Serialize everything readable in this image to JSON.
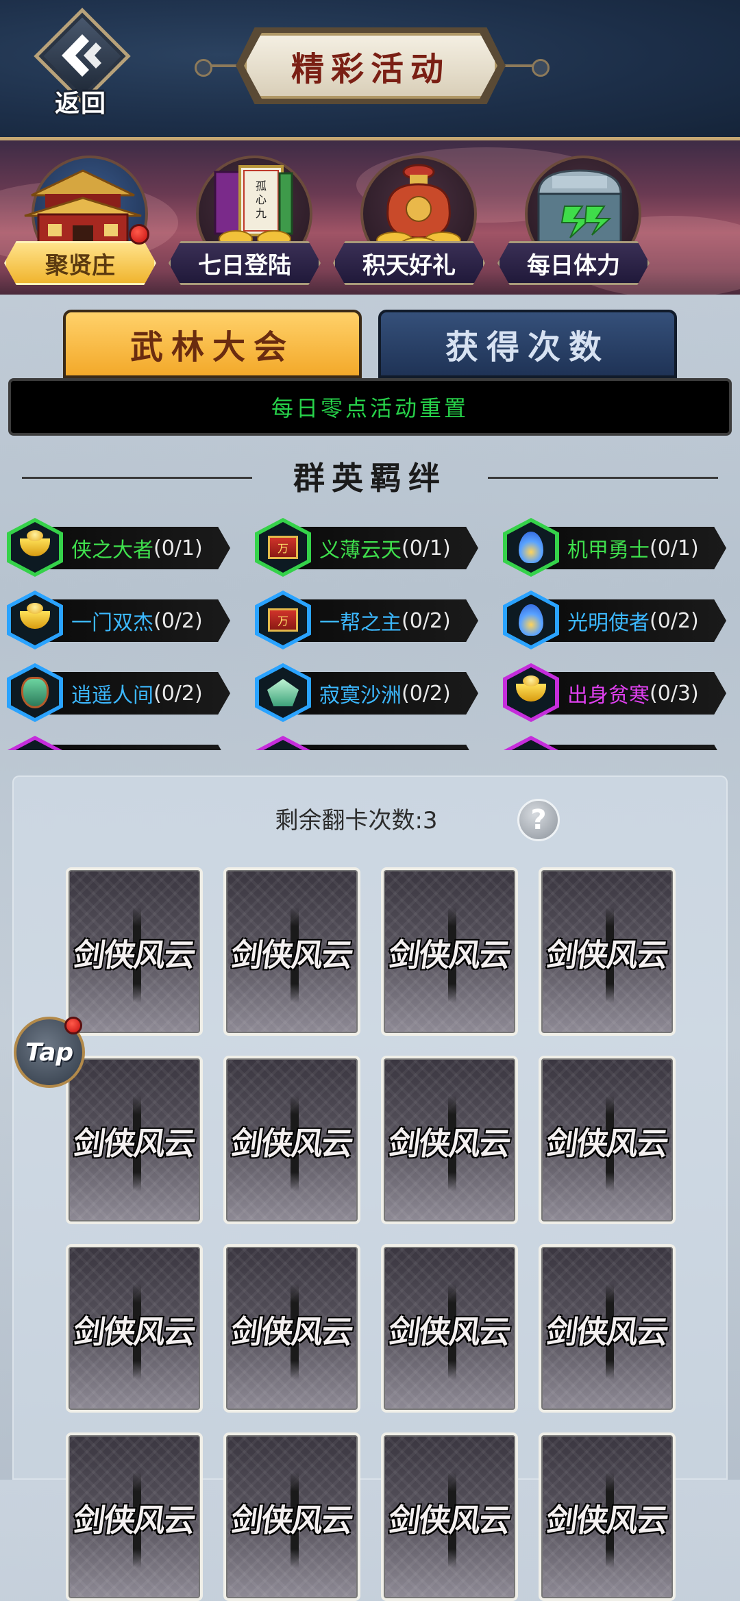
{
  "header": {
    "back_label": "返回",
    "title": "精彩活动"
  },
  "events": [
    {
      "label": "聚贤庄",
      "active": true,
      "has_notification": true,
      "icon": "palace-icon"
    },
    {
      "label": "七日登陆",
      "active": false,
      "has_notification": false,
      "icon": "scroll-book-icon"
    },
    {
      "label": "积天好礼",
      "active": false,
      "has_notification": false,
      "icon": "treasure-bag-icon"
    },
    {
      "label": "每日体力",
      "active": false,
      "has_notification": false,
      "icon": "chest-icon"
    }
  ],
  "tabs": [
    {
      "label": "武林大会",
      "active": true
    },
    {
      "label": "获得次数",
      "active": false
    }
  ],
  "notice": "每日零点活动重置",
  "section_title": "群英羁绊",
  "bonds": [
    {
      "name": "侠之大者",
      "count": "(0/1)",
      "tier": "green",
      "icon": "gold-ingot-icon"
    },
    {
      "name": "义薄云天",
      "count": "(0/1)",
      "tier": "green",
      "icon": "red-book-icon"
    },
    {
      "name": "机甲勇士",
      "count": "(0/1)",
      "tier": "green",
      "icon": "blue-flame-icon"
    },
    {
      "name": "一门双杰",
      "count": "(0/2)",
      "tier": "blue",
      "icon": "gold-ingot-icon"
    },
    {
      "name": "一帮之主",
      "count": "(0/2)",
      "tier": "blue",
      "icon": "red-book-icon"
    },
    {
      "name": "光明使者",
      "count": "(0/2)",
      "tier": "blue",
      "icon": "blue-flame-icon"
    },
    {
      "name": "逍遥人间",
      "count": "(0/2)",
      "tier": "blue",
      "icon": "jade-mask-icon"
    },
    {
      "name": "寂寞沙洲",
      "count": "(0/2)",
      "tier": "blue",
      "icon": "jade-emblem-icon"
    },
    {
      "name": "出身贫寒",
      "count": "(0/3)",
      "tier": "purple",
      "icon": "gold-ingot-icon"
    }
  ],
  "book_glyph": "万",
  "flip": {
    "label": "剩余翻卡次数:3",
    "help": "?"
  },
  "card_logo": "剑侠风云",
  "tap_label": "Tap",
  "colors": {
    "header_bg": "#1c2e48",
    "active_tab": "#f3a92a",
    "inactive_tab": "#1f3356",
    "notice_text": "#27d24a",
    "tier_green": "#35d24a",
    "tier_blue": "#2aa3ff",
    "tier_purple": "#c52ddb"
  }
}
